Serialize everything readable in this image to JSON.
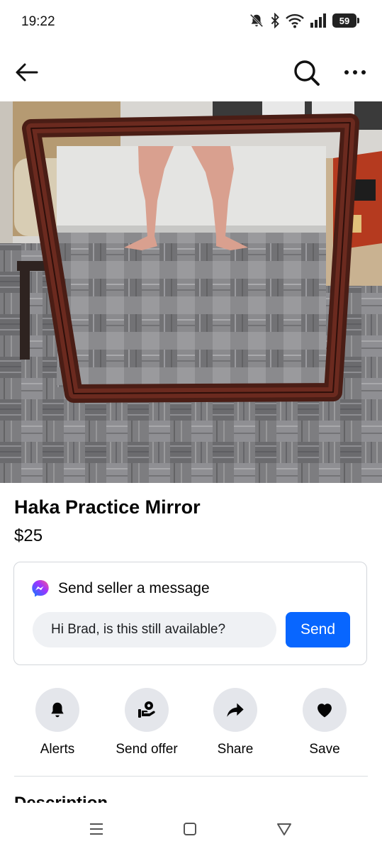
{
  "status_bar": {
    "time": "19:22",
    "battery": "59",
    "icons": [
      "bell-muted-icon",
      "bluetooth-icon",
      "wifi-icon",
      "signal-icon",
      "battery-icon"
    ]
  },
  "app_bar": {
    "icons": [
      "back-arrow-icon",
      "search-icon",
      "more-icon"
    ]
  },
  "listing": {
    "title": "Haka Practice Mirror",
    "price": "$25"
  },
  "message": {
    "title": "Send seller a message",
    "input_value": "Hi Brad, is this still available?",
    "send_label": "Send"
  },
  "actions": [
    {
      "label": "Alerts",
      "icon": "bell-icon"
    },
    {
      "label": "Send offer",
      "icon": "offer-icon"
    },
    {
      "label": "Share",
      "icon": "share-arrow-icon"
    },
    {
      "label": "Save",
      "icon": "heart-icon"
    }
  ],
  "description": {
    "heading": "Description"
  },
  "colors": {
    "accent": "#0866ff",
    "action_circle": "#e4e6eb",
    "input_bg": "#eff1f4"
  }
}
